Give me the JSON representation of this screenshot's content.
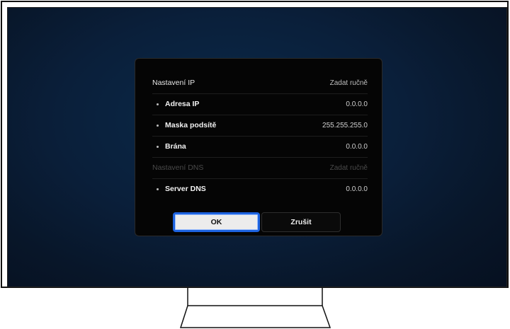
{
  "dialog": {
    "ip_settings": {
      "label": "Nastavení IP",
      "value": "Zadat ručně"
    },
    "ip_address": {
      "label": "Adresa IP",
      "value": "0.0.0.0"
    },
    "subnet_mask": {
      "label": "Maska podsítě",
      "value": "255.255.255.0"
    },
    "gateway": {
      "label": "Brána",
      "value": "0.0.0.0"
    },
    "dns_settings": {
      "label": "Nastavení DNS",
      "value": "Zadat ručně"
    },
    "dns_server": {
      "label": "Server DNS",
      "value": "0.0.0.0"
    },
    "ok_label": "OK",
    "cancel_label": "Zrušit"
  },
  "colors": {
    "focus": "#1d63e0",
    "screen_bg": "#0a1f3a",
    "dialog_bg": "#050505"
  }
}
